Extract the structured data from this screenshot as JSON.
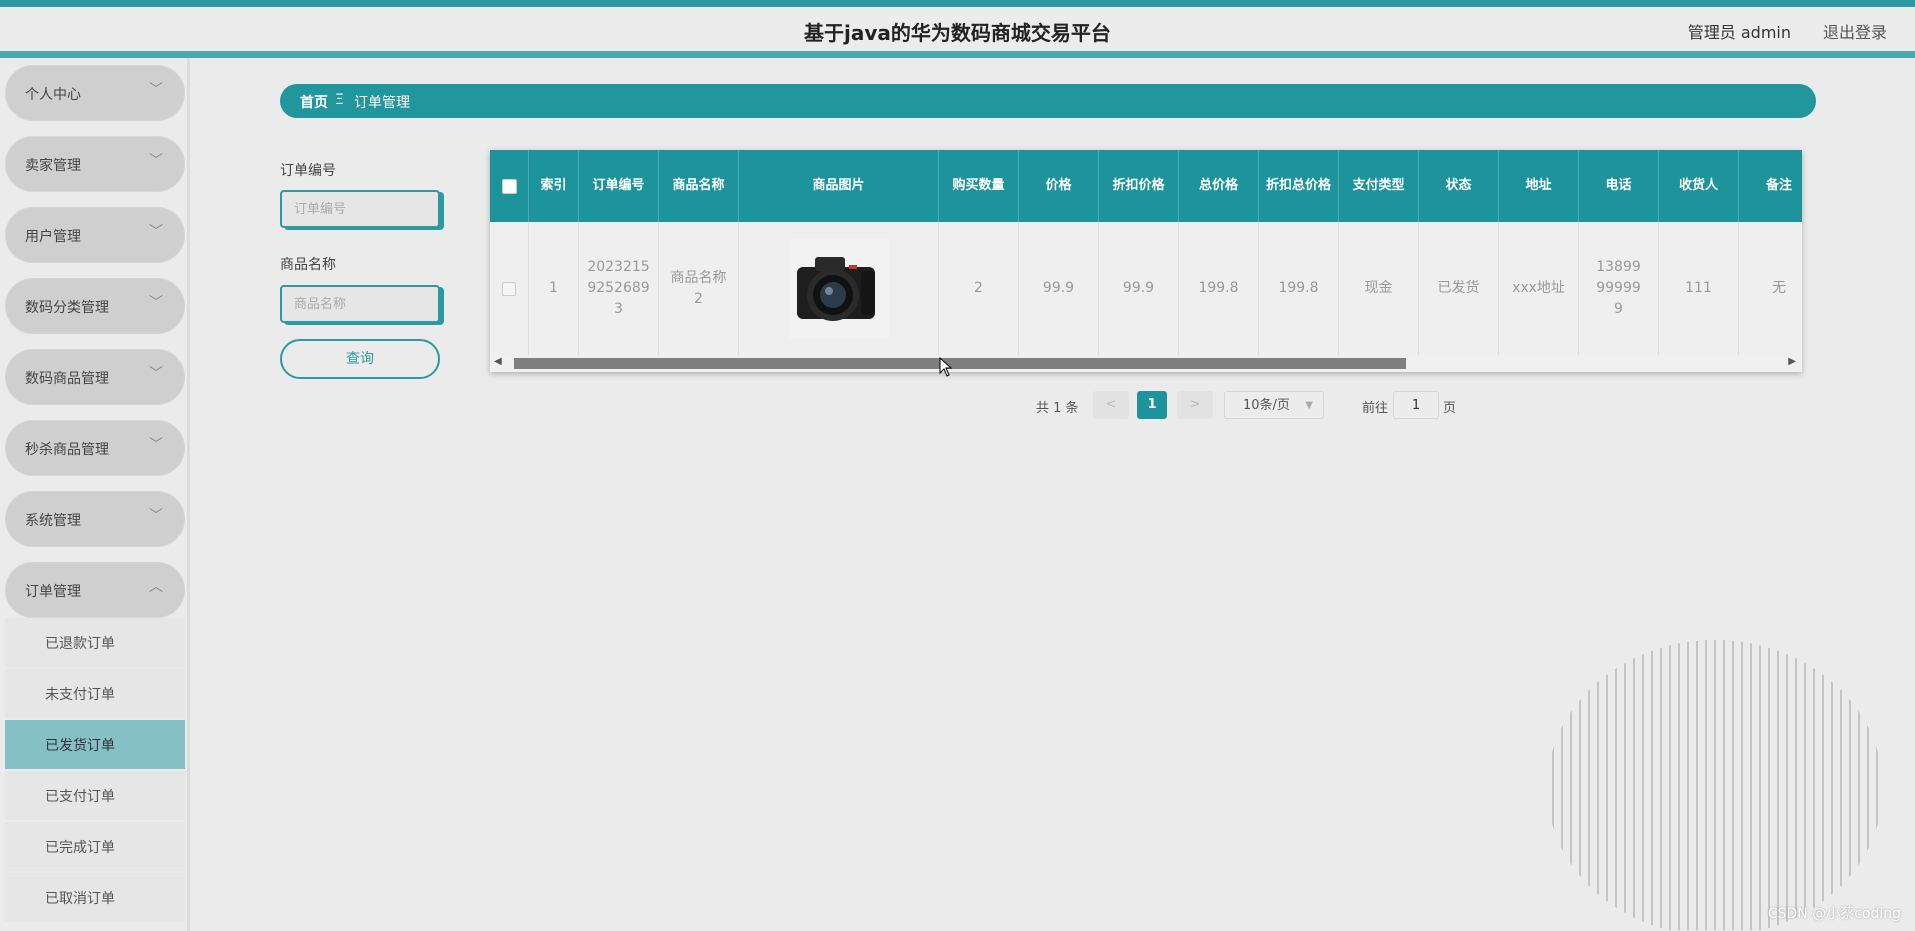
{
  "header": {
    "title": "基于java的华为数码商城交易平台",
    "user": "管理员 admin",
    "logout": "退出登录"
  },
  "sidebar": {
    "items": [
      {
        "label": "个人中心"
      },
      {
        "label": "卖家管理"
      },
      {
        "label": "用户管理"
      },
      {
        "label": "数码分类管理"
      },
      {
        "label": "数码商品管理"
      },
      {
        "label": "秒杀商品管理"
      },
      {
        "label": "系统管理"
      },
      {
        "label": "订单管理"
      }
    ],
    "chevron_down": "﹀",
    "chevron_up": "︿",
    "subitems": [
      {
        "label": "已退款订单"
      },
      {
        "label": "未支付订单"
      },
      {
        "label": "已发货订单",
        "active": true
      },
      {
        "label": "已支付订单"
      },
      {
        "label": "已完成订单"
      },
      {
        "label": "已取消订单"
      }
    ]
  },
  "breadcrumb": {
    "home": "首页",
    "separator": "Ξ",
    "current": "订单管理"
  },
  "search": {
    "order_no_label": "订单编号",
    "order_no_placeholder": "订单编号",
    "product_name_label": "商品名称",
    "product_name_placeholder": "商品名称",
    "query_button": "查询"
  },
  "table": {
    "columns": [
      "索引",
      "订单编号",
      "商品名称",
      "商品图片",
      "购买数量",
      "价格",
      "折扣价格",
      "总价格",
      "折扣总价格",
      "支付类型",
      "状态",
      "地址",
      "电话",
      "收货人",
      "备注"
    ],
    "rows": [
      {
        "index": "1",
        "order_no": "202321592526893",
        "product_name": "商品名称2",
        "image": "camera-photo",
        "quantity": "2",
        "price": "99.9",
        "discount_price": "99.9",
        "total": "199.8",
        "discount_total": "199.8",
        "pay_type": "现金",
        "status": "已发货",
        "address": "xxx地址",
        "phone": "13899999999",
        "receiver": "111",
        "remark": "无"
      }
    ]
  },
  "pagination": {
    "total_text": "共 1 条",
    "prev": "<",
    "current_page": "1",
    "next": ">",
    "page_size": "10条/页",
    "goto_prefix": "前往",
    "goto_value": "1",
    "goto_suffix": "页"
  },
  "watermark": "CSDN @小蔡coding",
  "colors": {
    "primary": "#1d949b",
    "active_menu": "#85c0c6"
  }
}
